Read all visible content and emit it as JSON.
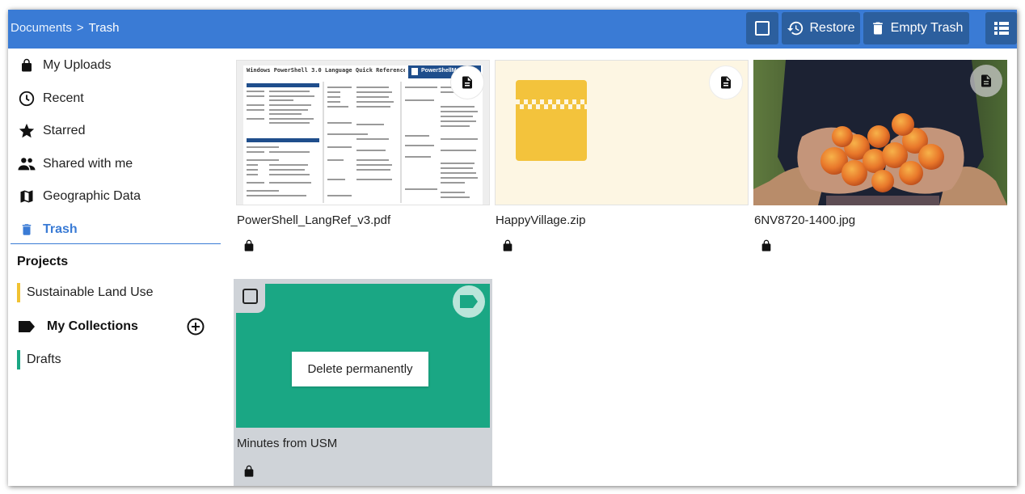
{
  "breadcrumb": {
    "root": "Documents",
    "separator": ">",
    "current": "Trash"
  },
  "toolbar": {
    "select_icon": "checkbox-outline-icon",
    "restore_label": "Restore",
    "restore_icon": "restore-icon",
    "empty_trash_label": "Empty Trash",
    "empty_trash_icon": "trash-icon",
    "view_toggle_icon": "list-view-icon"
  },
  "sidebar": {
    "items": [
      {
        "label": "My Uploads",
        "icon": "lock-icon",
        "active": false
      },
      {
        "label": "Recent",
        "icon": "clock-icon",
        "active": false
      },
      {
        "label": "Starred",
        "icon": "star-icon",
        "active": false
      },
      {
        "label": "Shared with me",
        "icon": "people-icon",
        "active": false
      },
      {
        "label": "Geographic Data",
        "icon": "map-icon",
        "active": false
      },
      {
        "label": "Trash",
        "icon": "trash-icon",
        "active": true
      }
    ],
    "projects_title": "Projects",
    "projects": [
      {
        "label": "Sustainable Land Use",
        "color": "#f1c232"
      }
    ],
    "collections_title": "My Collections",
    "collections_icon": "label-icon",
    "add_collection_icon": "add-circle-icon",
    "collections": [
      {
        "label": "Drafts",
        "color": "#1aa784"
      }
    ]
  },
  "files": [
    {
      "name": "PowerShell_LangRef_v3.pdf",
      "type_icon": "document-icon",
      "locked": true,
      "preview_title": "Windows PowerShell 3.0 Language Quick Reference",
      "preview_brand": "PowerShellMagazine"
    },
    {
      "name": "HappyVillage.zip",
      "type_icon": "document-icon",
      "locked": true,
      "preview_color": "#f3c33c"
    },
    {
      "name": "6NV8720-1400.jpg",
      "type_icon": "document-icon",
      "locked": true
    },
    {
      "name": "Minutes from USM",
      "type_icon": "label-icon",
      "locked": true,
      "selected": true,
      "preview_color": "#1aa784",
      "action_label": "Delete permanently"
    }
  ],
  "colors": {
    "accent": "#3a7bd5",
    "toolbar_button": "#2c5f9e",
    "selected_card": "#cfd3d8"
  }
}
